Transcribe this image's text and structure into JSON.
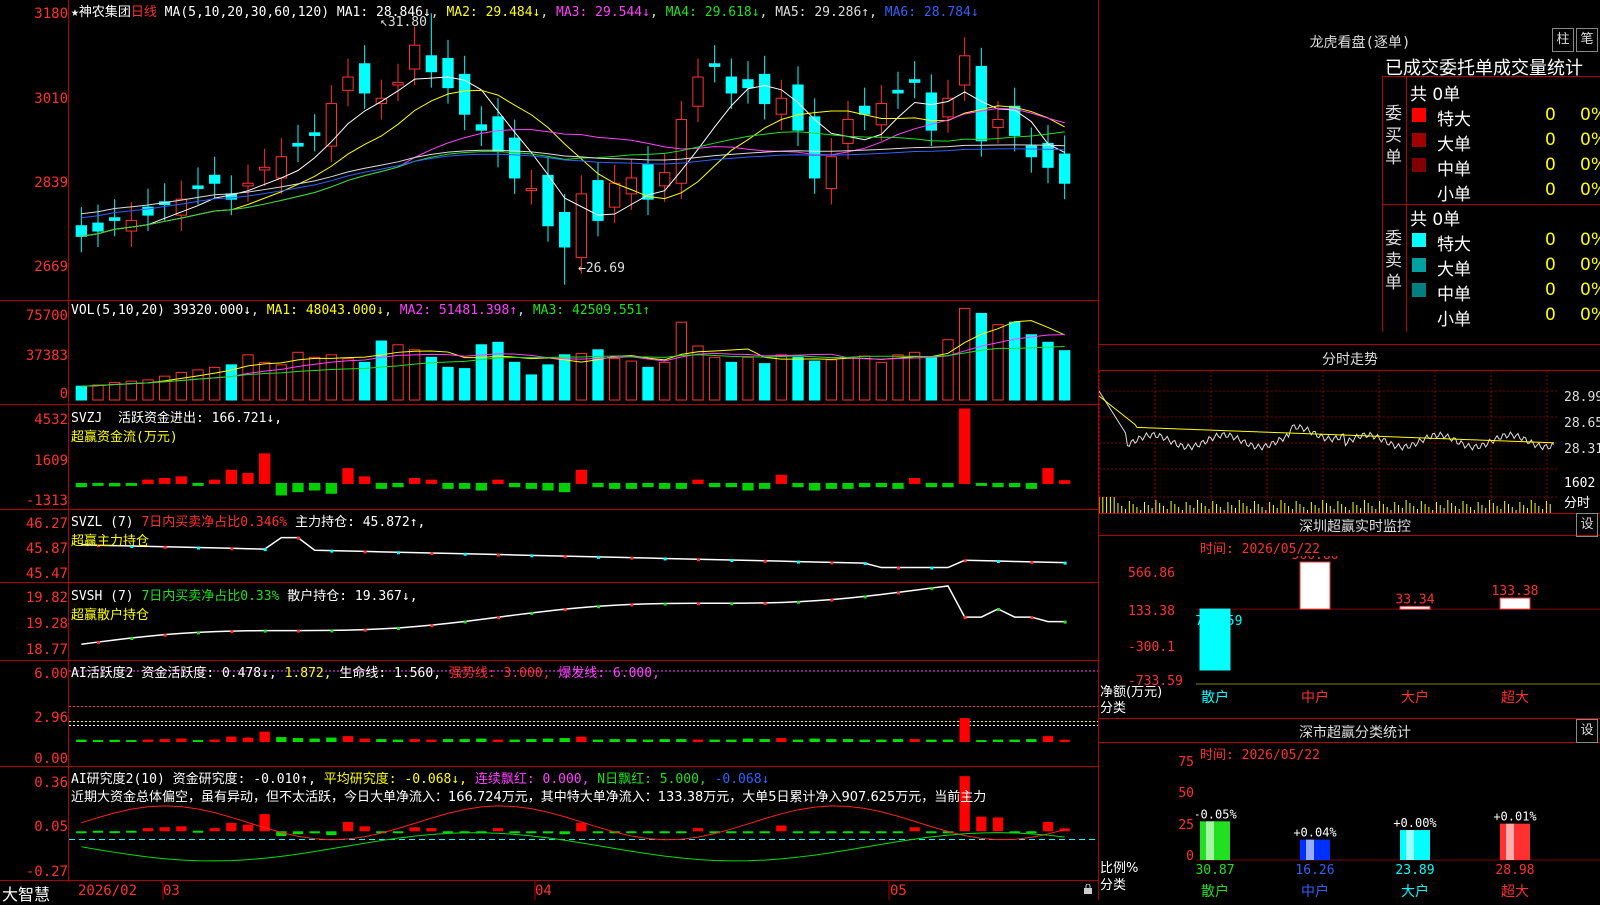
{
  "stock": {
    "name": "★神农集团",
    "period": "日线",
    "ma_label": "MA(5,10,20,30,60,120)"
  },
  "main_ma": [
    {
      "label": "MA1: 28.846↓",
      "color": "#ffffff"
    },
    {
      "label": "MA2: 29.484↓",
      "color": "#ffff00"
    },
    {
      "label": "MA3: 29.544↓",
      "color": "#ff40ff"
    },
    {
      "label": "MA4: 29.618↓",
      "color": "#20e020"
    },
    {
      "label": "MA5: 29.286↑",
      "color": "#dddddd"
    },
    {
      "label": "MA6: 28.784↓",
      "color": "#3060ff"
    }
  ],
  "main_axis": [
    "3180",
    "3010",
    "2839",
    "2669"
  ],
  "high_note": "31.80",
  "low_note": "←26.69",
  "vol": {
    "label": "VOL(5,10,20)",
    "value": "39320.000↓",
    "ma1": "MA1: 48043.000↓",
    "ma2": "MA2: 51481.398↑",
    "ma3": "MA3: 42509.551↑",
    "axis": [
      "75700",
      "37383",
      "0"
    ]
  },
  "svzj": {
    "label": "SVZJ",
    "t1": "活跃资金进出: 166.721↓,",
    "t2": "超赢资金流(万元)",
    "axis": [
      "4532",
      "1609",
      "-1313"
    ]
  },
  "svzl": {
    "label": "SVZL (7)",
    "t1": "7日内买卖净占比0.346%",
    "t2": "主力持仓: 45.872↑,",
    "t3": "超赢主力持仓",
    "axis": [
      "46.27",
      "45.87",
      "45.47"
    ]
  },
  "svsh": {
    "label": "SVSH (7)",
    "t1": "7日内买卖净占比0.33%",
    "t2": "散户持仓: 19.367↓,",
    "t3": "超赢散户持仓",
    "axis": [
      "19.82",
      "19.28",
      "18.77"
    ]
  },
  "ai1": {
    "t1": "AI活跃度2",
    "t2": "资金活跃度: 0.478↓,",
    "t3": "1.872,",
    "t4": "生命线: 1.560,",
    "t5": "强势线: 3.000,",
    "t6": "爆发线: 6.000,",
    "axis": [
      "6.00",
      "2.96",
      "0.00"
    ]
  },
  "ai2": {
    "t1": "AI研究度2(10)",
    "t2": "资金研究度: -0.010↑,",
    "t3": "平均研究度: -0.068↓,",
    "t4": "连续飘红: 0.000,",
    "t5": "N日飘红: 5.000,",
    "t6": "-0.068↓",
    "axis": [
      "0.36",
      "0.05",
      "-0.27"
    ],
    "comment": "近期大资金总体偏空，虽有异动，但不太活跃，今日大单净流入：166.724万元，其中特大单净流入：133.38万元，大单5日累计净入907.625万元，当前主力"
  },
  "xaxis": {
    "brand": "大智慧",
    "labels": [
      "2026/02",
      "03",
      "04",
      "05"
    ]
  },
  "longhu": {
    "title": "龙虎看盘(逐单)",
    "btn1": "柱",
    "btn2": "笔",
    "header": "已成交委托单成交量统计",
    "buy": {
      "side": "委买单",
      "total": "共 0单",
      "rows": [
        {
          "n": "特大",
          "v": "0",
          "p": "0%",
          "c": "#ff0000"
        },
        {
          "n": "大单",
          "v": "0",
          "p": "0%",
          "c": "#a00000"
        },
        {
          "n": "中单",
          "v": "0",
          "p": "0%",
          "c": "#800000"
        },
        {
          "n": "小单",
          "v": "0",
          "p": "0%",
          "c": ""
        }
      ]
    },
    "sell": {
      "side": "委卖单",
      "total": "共 0单",
      "rows": [
        {
          "n": "特大",
          "v": "0",
          "p": "0%",
          "c": "#00ffff"
        },
        {
          "n": "大单",
          "v": "0",
          "p": "0%",
          "c": "#00a0a0"
        },
        {
          "n": "中单",
          "v": "0",
          "p": "0%",
          "c": "#008080"
        },
        {
          "n": "小单",
          "v": "0",
          "p": "0%",
          "c": ""
        }
      ]
    }
  },
  "intraday": {
    "title": "分时走势",
    "axis": [
      "28.99",
      "28.65",
      "28.31"
    ],
    "vol_label": "1602",
    "vol_unit": "分时"
  },
  "monitor": {
    "title": "深圳超赢实时监控",
    "btn": "设",
    "time": "时间: 2026/05/22",
    "axis": [
      "566.86",
      "133.38",
      "-300.1",
      "-733.59"
    ],
    "unit1": "净额(万元)",
    "unit2": "分类",
    "bars": [
      {
        "cat": "散户",
        "label": "-733.59"
      },
      {
        "cat": "中户",
        "label": "566.86"
      },
      {
        "cat": "大户",
        "label": "33.34"
      },
      {
        "cat": "超大",
        "label": "133.38"
      }
    ]
  },
  "classstat": {
    "title": "深市超赢分类统计",
    "btn": "设",
    "time": "时间: 2026/05/22",
    "axis": [
      "75",
      "50",
      "25",
      "0"
    ],
    "unit1": "比例%",
    "unit2": "分类",
    "bars": [
      {
        "cat": "散户",
        "top": "-0.05%",
        "bottom": "30.87"
      },
      {
        "cat": "中户",
        "top": "+0.04%",
        "bottom": "16.26"
      },
      {
        "cat": "大户",
        "top": "+0.00%",
        "bottom": "23.89"
      },
      {
        "cat": "超大",
        "top": "+0.01%",
        "bottom": "28.98"
      }
    ]
  },
  "chart_data": [
    {
      "type": "candlestick",
      "title": "神农集团 日线",
      "x_range": [
        "2026/02",
        "2026/05/22"
      ],
      "ylim": [
        26.69,
        31.8
      ],
      "annotations": {
        "high": 31.8,
        "low": 26.69
      },
      "series": [
        {
          "name": "MA1",
          "last": 28.846
        },
        {
          "name": "MA2",
          "last": 29.484
        },
        {
          "name": "MA3",
          "last": 29.544
        },
        {
          "name": "MA4",
          "last": 29.618
        },
        {
          "name": "MA5",
          "last": 29.286
        },
        {
          "name": "MA6",
          "last": 28.784
        }
      ],
      "close": [
        27.6,
        27.7,
        27.9,
        27.9,
        28.0,
        28.2,
        28.3,
        28.5,
        28.6,
        28.3,
        28.6,
        28.9,
        29.1,
        29.3,
        29.5,
        30.1,
        30.6,
        30.3,
        30.2,
        30.5,
        31.2,
        30.7,
        30.4,
        29.9,
        29.6,
        29.2,
        28.7,
        28.5,
        27.8,
        27.4,
        28.4,
        27.9,
        28.6,
        28.7,
        28.3,
        28.8,
        29.8,
        30.6,
        30.8,
        30.3,
        30.4,
        30.1,
        30.2,
        29.6,
        28.7,
        29.1,
        29.8,
        29.9,
        30.1,
        30.3,
        30.5,
        29.6,
        30.2,
        31.0,
        29.4,
        29.8,
        29.5,
        29.1,
        28.9,
        28.6
      ]
    },
    {
      "type": "bar",
      "title": "VOL(5,10,20)",
      "ylim": [
        0,
        75700
      ],
      "values": [
        11000,
        12000,
        14000,
        15000,
        16000,
        19000,
        22000,
        24000,
        26000,
        28000,
        36000,
        30000,
        28000,
        38000,
        34000,
        36000,
        33000,
        30000,
        47000,
        44000,
        40000,
        34000,
        26000,
        25000,
        44000,
        46000,
        30000,
        20000,
        28000,
        36000,
        37000,
        40000,
        33000,
        31000,
        26000,
        30000,
        62000,
        43000,
        34000,
        30000,
        34000,
        29000,
        36000,
        34000,
        31000,
        32000,
        34000,
        35000,
        30000,
        36000,
        38000,
        34000,
        48000,
        73000,
        69000,
        60000,
        62000,
        52000,
        46000,
        39320
      ]
    },
    {
      "type": "bar",
      "title": "超赢资金流(万元)",
      "ylim": [
        -1313,
        4532
      ],
      "values": [
        -200,
        -100,
        -150,
        -100,
        200,
        300,
        400,
        -100,
        200,
        800,
        600,
        1800,
        -700,
        -500,
        -400,
        -600,
        900,
        400,
        -300,
        -200,
        300,
        200,
        -300,
        -300,
        -400,
        200,
        -200,
        -300,
        -400,
        -500,
        800,
        -200,
        -300,
        -300,
        -200,
        -300,
        -300,
        200,
        -200,
        -200,
        -400,
        -300,
        500,
        -200,
        -400,
        -300,
        -300,
        -200,
        -200,
        -300,
        300,
        -200,
        -200,
        4532,
        -100,
        -200,
        -200,
        -300,
        900,
        166.721
      ]
    },
    {
      "type": "line",
      "title": "超赢主力持仓",
      "ylim": [
        45.47,
        46.27
      ],
      "last": 45.872
    },
    {
      "type": "line",
      "title": "超赢散户持仓",
      "ylim": [
        18.77,
        19.82
      ],
      "last": 19.367
    },
    {
      "type": "bar",
      "title": "AI活跃度2",
      "ylim": [
        0,
        6.0
      ],
      "series": [
        {
          "name": "资金活跃度",
          "last": 0.478
        }
      ],
      "lines": {
        "生命线": 1.56,
        "强势线": 3.0,
        "爆发线": 6.0
      }
    },
    {
      "type": "bar",
      "title": "AI研究度2(10)",
      "ylim": [
        -0.27,
        0.36
      ],
      "series": [
        {
          "name": "资金研究度",
          "last": -0.01
        },
        {
          "name": "平均研究度",
          "last": -0.068
        }
      ]
    },
    {
      "type": "bar",
      "title": "深圳超赢实时监控",
      "categories": [
        "散户",
        "中户",
        "大户",
        "超大"
      ],
      "values": [
        -733.59,
        566.86,
        33.34,
        133.38
      ],
      "ylabel": "净额(万元)",
      "ylim": [
        -733.59,
        566.86
      ]
    },
    {
      "type": "bar",
      "title": "深市超赢分类统计",
      "categories": [
        "散户",
        "中户",
        "大户",
        "超大"
      ],
      "values": [
        30.87,
        16.26,
        23.89,
        28.98
      ],
      "change": [
        "-0.05%",
        "+0.04%",
        "+0.00%",
        "+0.01%"
      ],
      "ylabel": "比例%",
      "ylim": [
        0,
        75
      ]
    }
  ]
}
